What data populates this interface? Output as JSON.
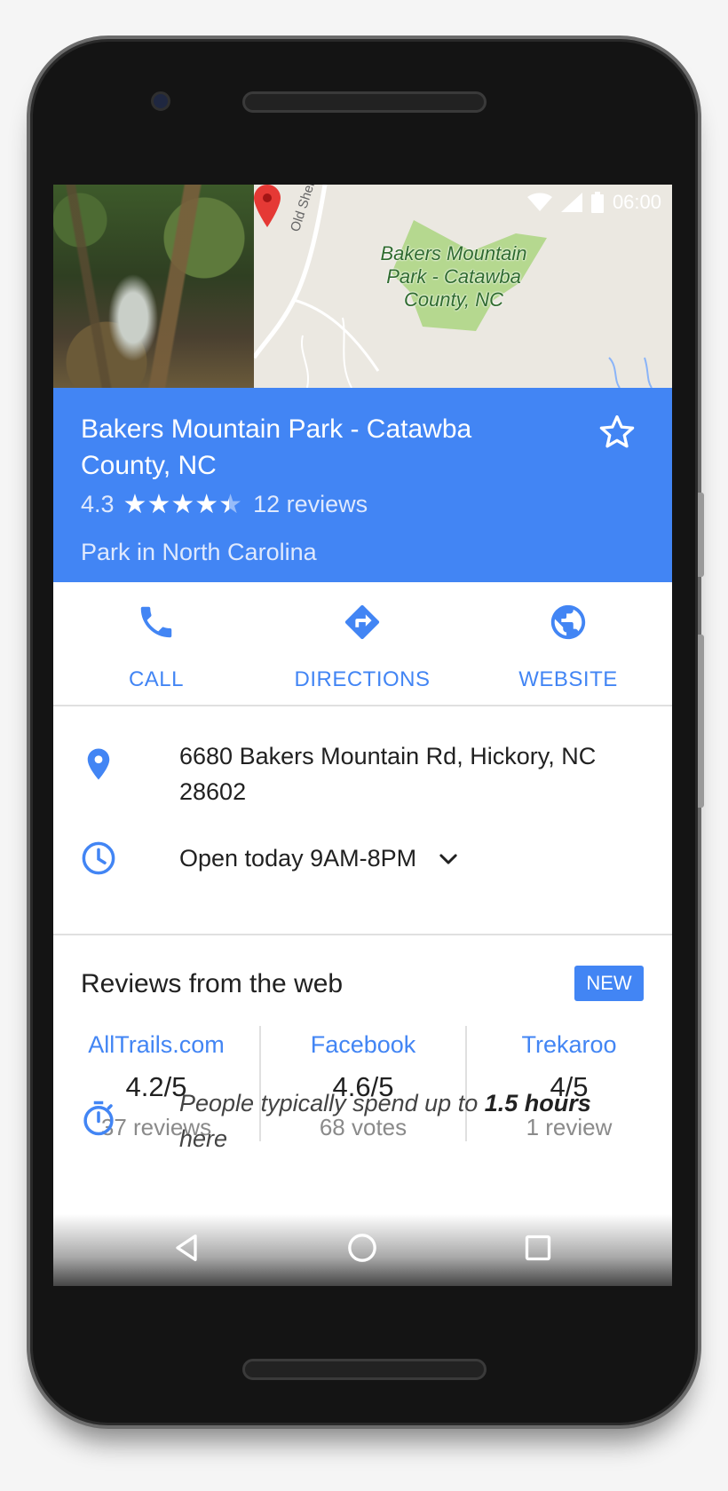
{
  "status_bar": {
    "time": "06:00"
  },
  "map": {
    "park_label": "Bakers Mountain Park - Catawba County, NC",
    "road_label": "Old Shelby Rd"
  },
  "place": {
    "name": "Bakers Mountain Park - Catawba County, NC",
    "rating": "4.3",
    "rating_value": 4.3,
    "reviews_count": "12 reviews",
    "category": "Park in North Carolina"
  },
  "actions": [
    {
      "label": "CALL",
      "icon": "phone-icon"
    },
    {
      "label": "DIRECTIONS",
      "icon": "directions-icon"
    },
    {
      "label": "WEBSITE",
      "icon": "globe-icon"
    }
  ],
  "info": {
    "address": "6680 Bakers Mountain Rd, Hickory, NC 28602",
    "hours": "Open today 9AM-8PM"
  },
  "reviews": {
    "title": "Reviews from the web",
    "badge": "NEW",
    "sources": [
      {
        "name": "AllTrails.com",
        "score": "4.2/5",
        "count": "37 reviews"
      },
      {
        "name": "Facebook",
        "score": "4.6/5",
        "count": "68 votes"
      },
      {
        "name": "Trekaroo",
        "score": "4/5",
        "count": "1 review"
      }
    ]
  },
  "spend": {
    "prefix": "People typically spend up to ",
    "duration": "1.5 hours",
    "suffix": " here"
  },
  "colors": {
    "accent": "#4285f4",
    "map_green": "#b5d88f",
    "pin_red": "#e53935"
  }
}
